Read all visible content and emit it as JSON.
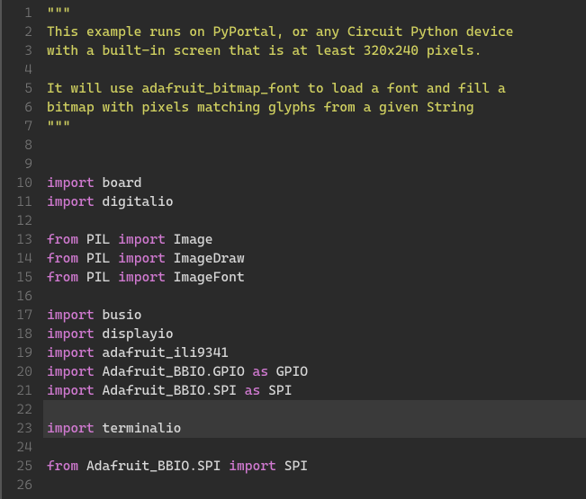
{
  "lines": [
    {
      "n": 1,
      "hl": false,
      "seg": [
        {
          "c": "str",
          "t": "\"\"\""
        }
      ]
    },
    {
      "n": 2,
      "hl": false,
      "seg": [
        {
          "c": "str",
          "t": "This example runs on PyPortal, or any Circuit Python device"
        }
      ]
    },
    {
      "n": 3,
      "hl": false,
      "seg": [
        {
          "c": "str",
          "t": "with a built-in screen that is at least 320x240 pixels."
        }
      ]
    },
    {
      "n": 4,
      "hl": false,
      "seg": []
    },
    {
      "n": 5,
      "hl": false,
      "seg": [
        {
          "c": "str",
          "t": "It will use adafruit_bitmap_font to load a font and fill a"
        }
      ]
    },
    {
      "n": 6,
      "hl": false,
      "seg": [
        {
          "c": "str",
          "t": "bitmap with pixels matching glyphs from a given String"
        }
      ]
    },
    {
      "n": 7,
      "hl": false,
      "seg": [
        {
          "c": "str",
          "t": "\"\"\""
        }
      ]
    },
    {
      "n": 8,
      "hl": false,
      "seg": []
    },
    {
      "n": 9,
      "hl": false,
      "seg": []
    },
    {
      "n": 10,
      "hl": false,
      "seg": [
        {
          "c": "kw",
          "t": "import "
        },
        {
          "c": "mod",
          "t": "board"
        }
      ]
    },
    {
      "n": 11,
      "hl": false,
      "seg": [
        {
          "c": "kw",
          "t": "import "
        },
        {
          "c": "mod",
          "t": "digitalio"
        }
      ]
    },
    {
      "n": 12,
      "hl": false,
      "seg": []
    },
    {
      "n": 13,
      "hl": false,
      "seg": [
        {
          "c": "kw",
          "t": "from "
        },
        {
          "c": "mod",
          "t": "PIL"
        },
        {
          "c": "kw",
          "t": " import "
        },
        {
          "c": "mod",
          "t": "Image"
        }
      ]
    },
    {
      "n": 14,
      "hl": false,
      "seg": [
        {
          "c": "kw",
          "t": "from "
        },
        {
          "c": "mod",
          "t": "PIL"
        },
        {
          "c": "kw",
          "t": " import "
        },
        {
          "c": "mod",
          "t": "ImageDraw"
        }
      ]
    },
    {
      "n": 15,
      "hl": false,
      "seg": [
        {
          "c": "kw",
          "t": "from "
        },
        {
          "c": "mod",
          "t": "PIL"
        },
        {
          "c": "kw",
          "t": " import "
        },
        {
          "c": "mod",
          "t": "ImageFont"
        }
      ]
    },
    {
      "n": 16,
      "hl": false,
      "seg": []
    },
    {
      "n": 17,
      "hl": false,
      "seg": [
        {
          "c": "kw",
          "t": "import "
        },
        {
          "c": "mod",
          "t": "busio"
        }
      ]
    },
    {
      "n": 18,
      "hl": false,
      "seg": [
        {
          "c": "kw",
          "t": "import "
        },
        {
          "c": "mod",
          "t": "displayio"
        }
      ]
    },
    {
      "n": 19,
      "hl": false,
      "seg": [
        {
          "c": "kw",
          "t": "import "
        },
        {
          "c": "mod",
          "t": "adafruit_ili9341"
        }
      ]
    },
    {
      "n": 20,
      "hl": false,
      "seg": [
        {
          "c": "kw",
          "t": "import "
        },
        {
          "c": "mod",
          "t": "Adafruit_BBIO.GPIO"
        },
        {
          "c": "kw",
          "t": " as "
        },
        {
          "c": "alias",
          "t": "GPIO"
        }
      ]
    },
    {
      "n": 21,
      "hl": false,
      "seg": [
        {
          "c": "kw",
          "t": "import "
        },
        {
          "c": "mod",
          "t": "Adafruit_BBIO.SPI"
        },
        {
          "c": "kw",
          "t": " as "
        },
        {
          "c": "alias",
          "t": "SPI"
        }
      ]
    },
    {
      "n": 22,
      "hl": true,
      "seg": []
    },
    {
      "n": 23,
      "hl": true,
      "seg": [
        {
          "c": "kw",
          "t": "import "
        },
        {
          "c": "mod",
          "t": "terminalio"
        }
      ]
    },
    {
      "n": 24,
      "hl": false,
      "seg": []
    },
    {
      "n": 25,
      "hl": false,
      "seg": [
        {
          "c": "kw",
          "t": "from "
        },
        {
          "c": "mod",
          "t": "Adafruit_BBIO.SPI"
        },
        {
          "c": "kw",
          "t": " import "
        },
        {
          "c": "mod",
          "t": "SPI"
        }
      ]
    },
    {
      "n": 26,
      "hl": false,
      "seg": []
    }
  ]
}
